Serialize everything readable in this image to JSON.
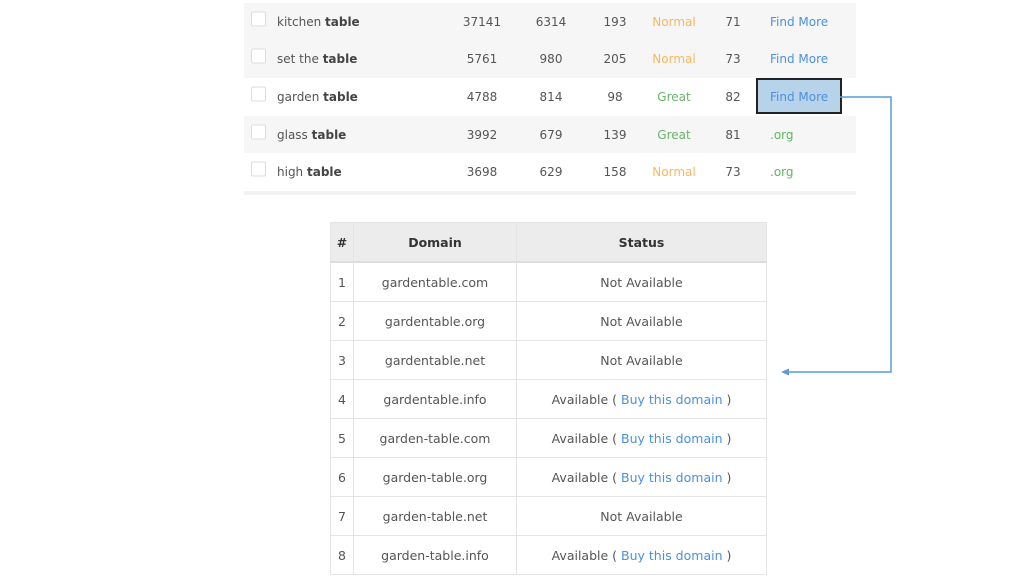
{
  "keywords": [
    {
      "prefix": "kitchen",
      "bold": "table",
      "v1": "37141",
      "v2": "6314",
      "v3": "193",
      "status": "Normal",
      "score": "71",
      "link": "Find More"
    },
    {
      "prefix": "set the",
      "bold": "table",
      "v1": "5761",
      "v2": "980",
      "v3": "205",
      "status": "Normal",
      "score": "73",
      "link": "Find More"
    },
    {
      "prefix": "garden",
      "bold": "table",
      "v1": "4788",
      "v2": "814",
      "v3": "98",
      "status": "Great",
      "score": "82",
      "link": "Find More"
    },
    {
      "prefix": "glass",
      "bold": "table",
      "v1": "3992",
      "v2": "679",
      "v3": "139",
      "status": "Great",
      "score": "81",
      "link": ".org"
    },
    {
      "prefix": "high",
      "bold": "table",
      "v1": "3698",
      "v2": "629",
      "v3": "158",
      "status": "Normal",
      "score": "73",
      "link": ".org"
    }
  ],
  "domains": {
    "headers": [
      "#",
      "Domain",
      "Status"
    ],
    "rows": [
      {
        "n": "1",
        "domain": "gardentable.com",
        "status": "Not Available"
      },
      {
        "n": "2",
        "domain": "gardentable.org",
        "status": "Not Available"
      },
      {
        "n": "3",
        "domain": "gardentable.net",
        "status": "Not Available"
      },
      {
        "n": "4",
        "domain": "gardentable.info",
        "status": "Available (",
        "buy": "Buy this domain",
        "close": ")"
      },
      {
        "n": "5",
        "domain": "garden-table.com",
        "status": "Available (",
        "buy": "Buy this domain",
        "close": ")"
      },
      {
        "n": "6",
        "domain": "garden-table.org",
        "status": "Available (",
        "buy": "Buy this domain",
        "close": ")"
      },
      {
        "n": "7",
        "domain": "garden-table.net",
        "status": "Not Available"
      },
      {
        "n": "8",
        "domain": "garden-table.info",
        "status": "Available (",
        "buy": "Buy this domain",
        "close": ")"
      }
    ]
  },
  "colors": {
    "arrow": "#5b9bd5",
    "highlight": "#b7d3ea",
    "link": "#4a90e2",
    "normal": "#f5b85f",
    "great": "#6ab56a"
  }
}
